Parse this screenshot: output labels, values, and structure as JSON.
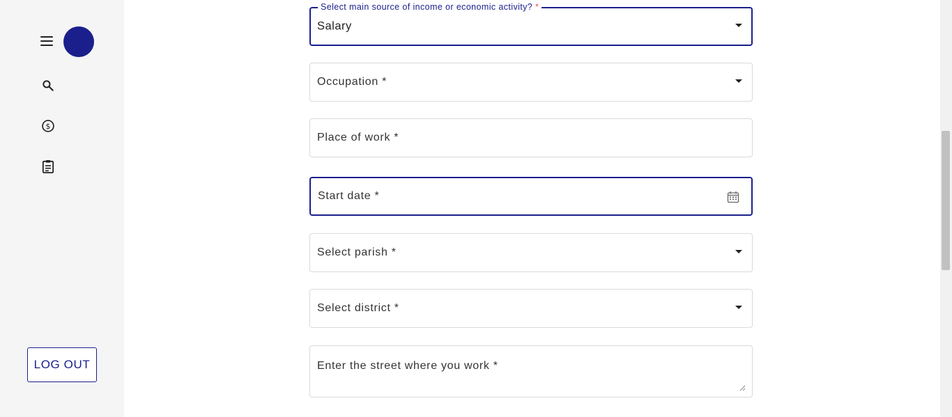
{
  "sidebar": {
    "menu_icon": "hamburger-menu-icon",
    "avatar_color": "#1a1f8c",
    "nav_icons": [
      "search-icon",
      "dollar-circle-icon",
      "clipboard-icon"
    ],
    "logout_label": "LOG OUT"
  },
  "form": {
    "income_source": {
      "label": "Select main source of income or economic activity?",
      "required_mark": "*",
      "value": "Salary"
    },
    "occupation": {
      "label": "Occupation *"
    },
    "place_of_work": {
      "label": "Place of work *"
    },
    "start_date": {
      "label": "Start date *"
    },
    "parish": {
      "label": "Select parish *"
    },
    "district": {
      "label": "Select district *"
    },
    "street": {
      "label": "Enter the street where you work *"
    }
  },
  "colors": {
    "accent": "#1a1f8c",
    "sidebar_bg": "#f5f5f5",
    "border": "#d9d9d9"
  }
}
